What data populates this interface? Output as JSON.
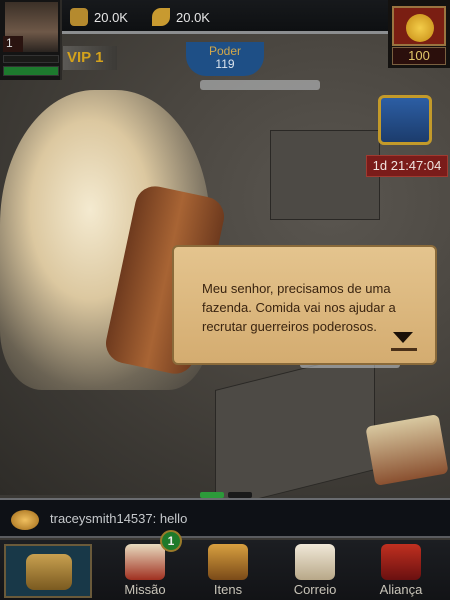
{
  "player": {
    "level": "1",
    "vip": "VIP 1",
    "power_label": "Poder",
    "power_value": "119"
  },
  "resources": [
    {
      "icon": "wood-icon",
      "value": "20.0K"
    },
    {
      "icon": "food-icon",
      "value": "20.0K"
    }
  ],
  "gold": {
    "value": "100"
  },
  "event": {
    "timer": "1d 21:47:04"
  },
  "dialog": {
    "text": "Meu senhor, precisamos de uma fazenda. Comida vai nos ajudar a recrutar guerreiros poderosos."
  },
  "chat": {
    "message": "traceysmith14537: hello"
  },
  "nav": {
    "items": [
      {
        "label": "Missão",
        "badge": "1"
      },
      {
        "label": "Itens"
      },
      {
        "label": "Correio"
      },
      {
        "label": "Aliança"
      }
    ]
  }
}
